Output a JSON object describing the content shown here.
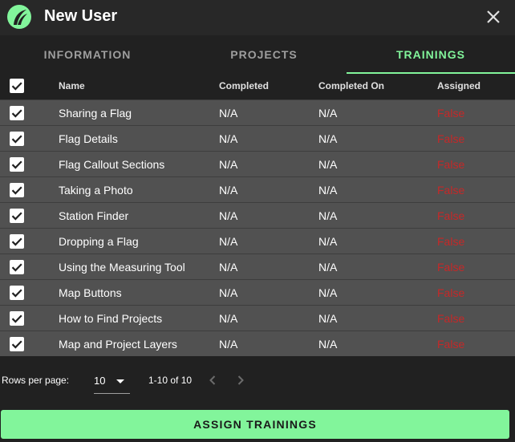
{
  "dialog": {
    "title": "New User",
    "logo_icon": "leaf-logo-icon",
    "close_icon": "close-icon"
  },
  "tabs": [
    {
      "label": "INFORMATION",
      "active": false
    },
    {
      "label": "PROJECTS",
      "active": false
    },
    {
      "label": "TRAININGS",
      "active": true
    }
  ],
  "table": {
    "columns": [
      "Name",
      "Completed",
      "Completed On",
      "Assigned"
    ],
    "select_all_checked": true,
    "rows": [
      {
        "checked": true,
        "name": "Sharing a Flag",
        "completed": "N/A",
        "completed_on": "N/A",
        "assigned": "False"
      },
      {
        "checked": true,
        "name": "Flag Details",
        "completed": "N/A",
        "completed_on": "N/A",
        "assigned": "False"
      },
      {
        "checked": true,
        "name": "Flag Callout Sections",
        "completed": "N/A",
        "completed_on": "N/A",
        "assigned": "False"
      },
      {
        "checked": true,
        "name": "Taking a Photo",
        "completed": "N/A",
        "completed_on": "N/A",
        "assigned": "False"
      },
      {
        "checked": true,
        "name": "Station Finder",
        "completed": "N/A",
        "completed_on": "N/A",
        "assigned": "False"
      },
      {
        "checked": true,
        "name": "Dropping a Flag",
        "completed": "N/A",
        "completed_on": "N/A",
        "assigned": "False"
      },
      {
        "checked": true,
        "name": "Using the Measuring Tool",
        "completed": "N/A",
        "completed_on": "N/A",
        "assigned": "False"
      },
      {
        "checked": true,
        "name": "Map Buttons",
        "completed": "N/A",
        "completed_on": "N/A",
        "assigned": "False"
      },
      {
        "checked": true,
        "name": "How to Find Projects",
        "completed": "N/A",
        "completed_on": "N/A",
        "assigned": "False"
      },
      {
        "checked": true,
        "name": "Map and Project Layers",
        "completed": "N/A",
        "completed_on": "N/A",
        "assigned": "False"
      }
    ]
  },
  "pagination": {
    "rows_per_page_label": "Rows per page:",
    "rows_per_page": "10",
    "range": "1-10 of 10",
    "prev_icon": "chevron-left-icon",
    "next_icon": "chevron-right-icon"
  },
  "actions": {
    "assign_label": "ASSIGN TRAININGS"
  },
  "colors": {
    "accent": "#82f59b",
    "false_text": "#c62828",
    "row_bg": "#515151",
    "dialog_bg": "#212121"
  }
}
